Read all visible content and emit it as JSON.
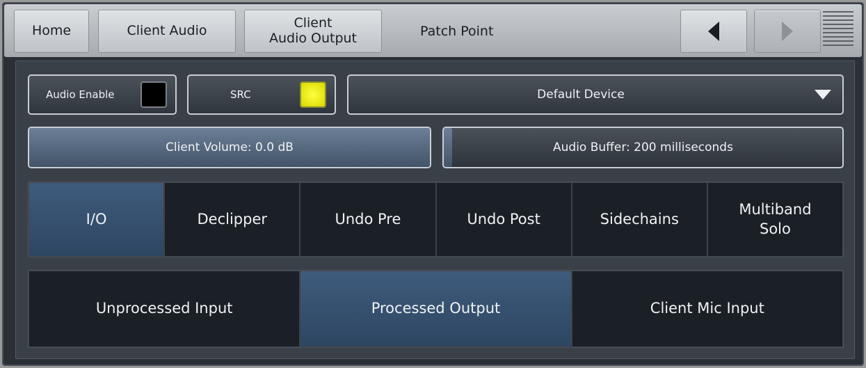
{
  "nav": {
    "home": "Home",
    "client_audio": "Client Audio",
    "client_audio_output": "Client\nAudio Output",
    "patch_point": "Patch Point",
    "back_icon": "triangle-left-icon",
    "forward_icon": "triangle-right-icon",
    "menu_icon": "hamburger-icon"
  },
  "controls": {
    "audio_enable": {
      "label": "Audio Enable",
      "led_color": "#000000",
      "state": "off"
    },
    "src": {
      "label": "SRC",
      "led_color": "#e6e600",
      "state": "on"
    },
    "device": {
      "value": "Default Device",
      "icon": "dropdown-triangle-icon"
    }
  },
  "sliders": {
    "client_volume": {
      "text": "Client Volume: 0.0 dB",
      "fill_fraction": 1.0
    },
    "audio_buffer": {
      "text": "Audio Buffer: 200 milliseconds",
      "fill_fraction": 0.02
    }
  },
  "tabs": [
    {
      "label": "I/O",
      "active": true
    },
    {
      "label": "Declipper",
      "active": false
    },
    {
      "label": "Undo Pre",
      "active": false
    },
    {
      "label": "Undo Post",
      "active": false
    },
    {
      "label": "Sidechains",
      "active": false
    },
    {
      "label": "Multiband\nSolo",
      "active": false
    }
  ],
  "sources": [
    {
      "label": "Unprocessed Input",
      "active": false
    },
    {
      "label": "Processed Output",
      "active": true
    },
    {
      "label": "Client Mic Input",
      "active": false
    }
  ],
  "colors": {
    "active_tab": "#3f5b7c",
    "src_led": "#e6e600",
    "panel_bg": "#3a4047"
  }
}
